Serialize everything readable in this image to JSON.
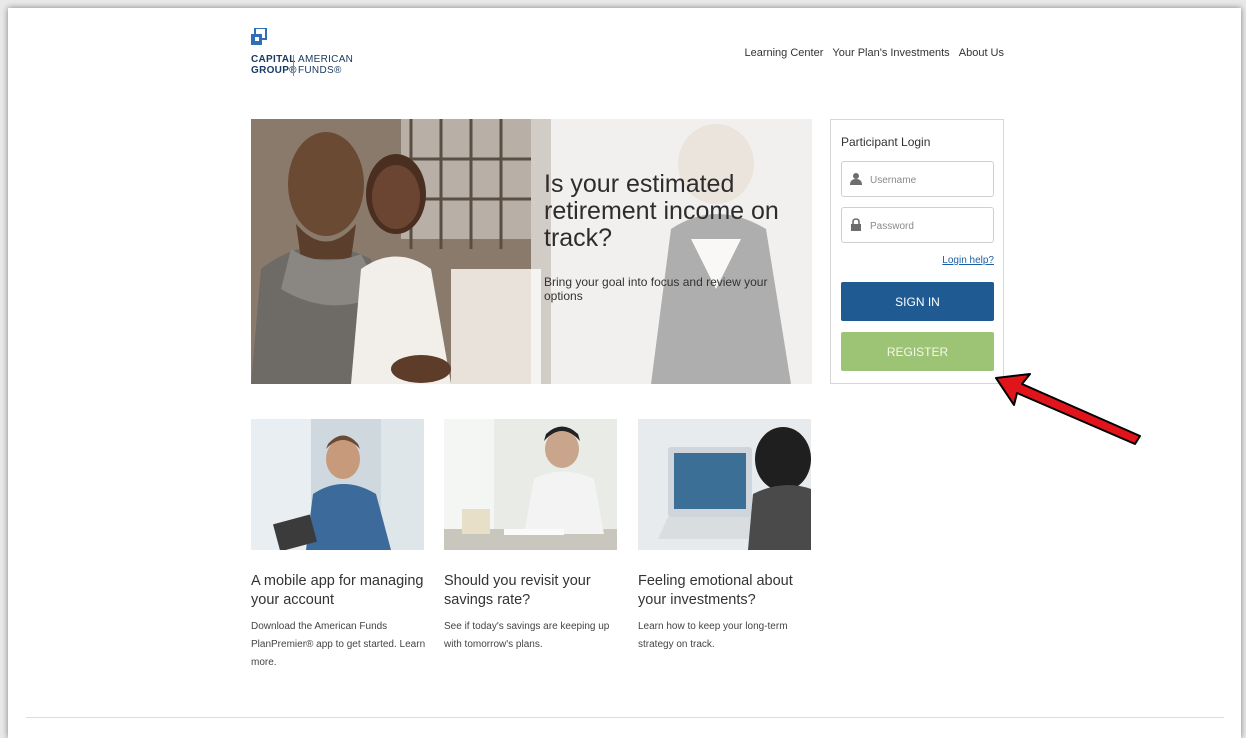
{
  "brand": {
    "name_left_line1": "CAPITAL",
    "name_left_line2": "GROUP®",
    "name_right_line1": "AMERICAN",
    "name_right_line2": "FUNDS®"
  },
  "nav": {
    "items": [
      "Learning Center",
      "Your Plan's Investments",
      "About Us"
    ]
  },
  "hero": {
    "title": "Is your estimated retirement income on track?",
    "subtitle": "Bring your goal into focus and review your options"
  },
  "login": {
    "title": "Participant Login",
    "username_placeholder": "Username",
    "password_placeholder": "Password",
    "help_link": "Login help?",
    "signin_label": "SIGN IN",
    "register_label": "REGISTER"
  },
  "cards": [
    {
      "title": "A mobile app for managing your account",
      "text": "Download the American Funds PlanPremier® app to get started. Learn more."
    },
    {
      "title": "Should you revisit your savings rate?",
      "text": "See if today's savings are keeping up with tomorrow's plans."
    },
    {
      "title": "Feeling emotional about your investments?",
      "text": "Learn how to keep your long-term strategy on track."
    }
  ],
  "colors": {
    "signin": "#1f5a92",
    "register": "#9dc375",
    "link": "#1a5fa8",
    "arrow": "#e0141b"
  }
}
